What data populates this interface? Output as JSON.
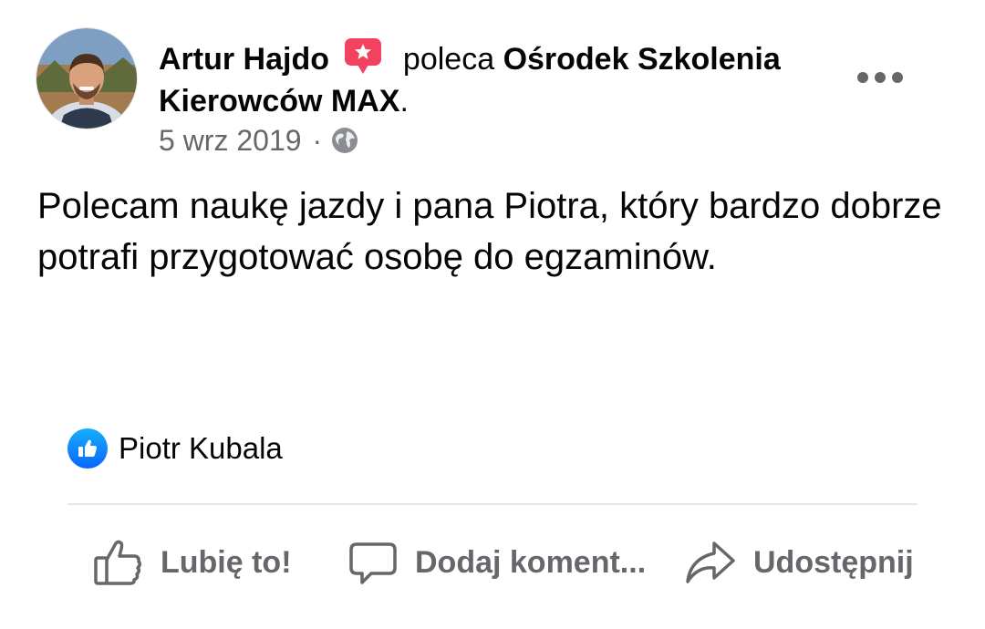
{
  "post": {
    "author_name": "Artur Hajdo",
    "recommend_verb": "poleca",
    "page_name": "Ośrodek Szkolenia Kierowców MAX",
    "page_name_suffix": ".",
    "date": "5 wrz 2019",
    "separator": "·",
    "audience_icon": "globe-icon",
    "text": "Polecam naukę jazdy i pana Piotra, który bardzo dobrze potrafi przygotować osobę do egzaminów."
  },
  "reactions": {
    "icon": "like-icon",
    "names": "Piotr Kubala"
  },
  "actions": {
    "like_label": "Lubię to!",
    "comment_label": "Dodaj koment...",
    "share_label": "Udostępnij"
  },
  "colors": {
    "recommend_badge": "#f3425f",
    "like_blue": "#0866ff",
    "secondary_text": "#65676b",
    "divider": "#e4e6eb"
  }
}
